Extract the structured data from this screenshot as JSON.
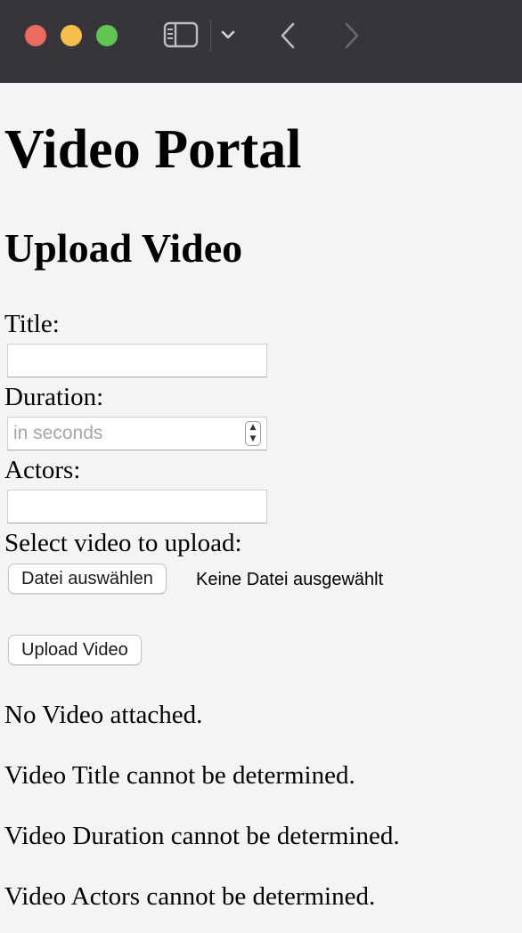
{
  "browser": {
    "traffic_lights": {
      "close": "#ed6a5e",
      "minimize": "#f5bf4f",
      "maximize": "#61c554"
    },
    "icons": [
      "sidebar-toggle-icon",
      "chevron-down-icon",
      "back-arrow-icon",
      "forward-arrow-icon"
    ]
  },
  "page": {
    "title": "Video Portal",
    "subtitle": "Upload Video"
  },
  "form": {
    "title_label": "Title:",
    "title_value": "",
    "duration_label": "Duration:",
    "duration_placeholder": "in seconds",
    "actors_label": "Actors:",
    "actors_value": "",
    "file_label": "Select video to upload:",
    "file_button": "Datei auswählen",
    "file_status": "Keine Datei ausgewählt",
    "submit_button": "Upload Video"
  },
  "messages": [
    "No Video attached.",
    "Video Title cannot be determined.",
    "Video Duration cannot be determined.",
    "Video Actors cannot be determined."
  ]
}
